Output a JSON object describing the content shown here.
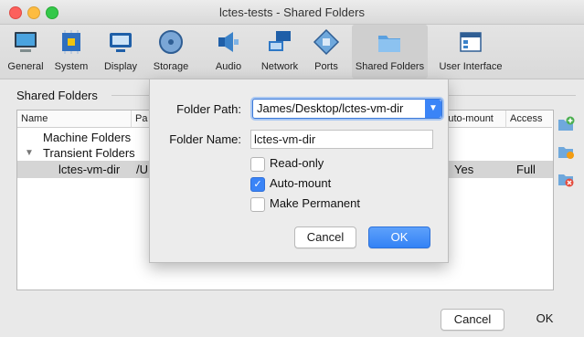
{
  "window": {
    "title": "lctes-tests - Shared Folders"
  },
  "toolbar": {
    "items": [
      {
        "label": "General",
        "icon": "monitor-icon"
      },
      {
        "label": "System",
        "icon": "chip-icon"
      },
      {
        "label": "Display",
        "icon": "display-icon"
      },
      {
        "label": "Storage",
        "icon": "disk-icon"
      },
      {
        "label": "Audio",
        "icon": "speaker-icon"
      },
      {
        "label": "Network",
        "icon": "network-icon"
      },
      {
        "label": "Ports",
        "icon": "ports-icon"
      },
      {
        "label": "Shared Folders",
        "icon": "folder-icon",
        "selected": true
      },
      {
        "label": "User Interface",
        "icon": "ui-window-icon"
      }
    ]
  },
  "group": {
    "title": "Shared Folders"
  },
  "table": {
    "columns": {
      "name": "Name",
      "path": "Pa",
      "automount": "Auto-mount",
      "access": "Access"
    },
    "rows": {
      "machine": "Machine Folders",
      "transient": "Transient Folders",
      "entry": {
        "name": "lctes-vm-dir",
        "path": "/U",
        "automount": "Yes",
        "access": "Full"
      }
    }
  },
  "dialog": {
    "path_label": "Folder Path:",
    "path_value": "James/Desktop/lctes-vm-dir",
    "name_label": "Folder Name:",
    "name_value": "lctes-vm-dir",
    "readonly_label": "Read-only",
    "automount_label": "Auto-mount",
    "permanent_label": "Make Permanent",
    "cancel": "Cancel",
    "ok": "OK"
  },
  "footer": {
    "cancel": "Cancel",
    "ok": "OK"
  },
  "colors": {
    "accent": "#3a84f7"
  }
}
